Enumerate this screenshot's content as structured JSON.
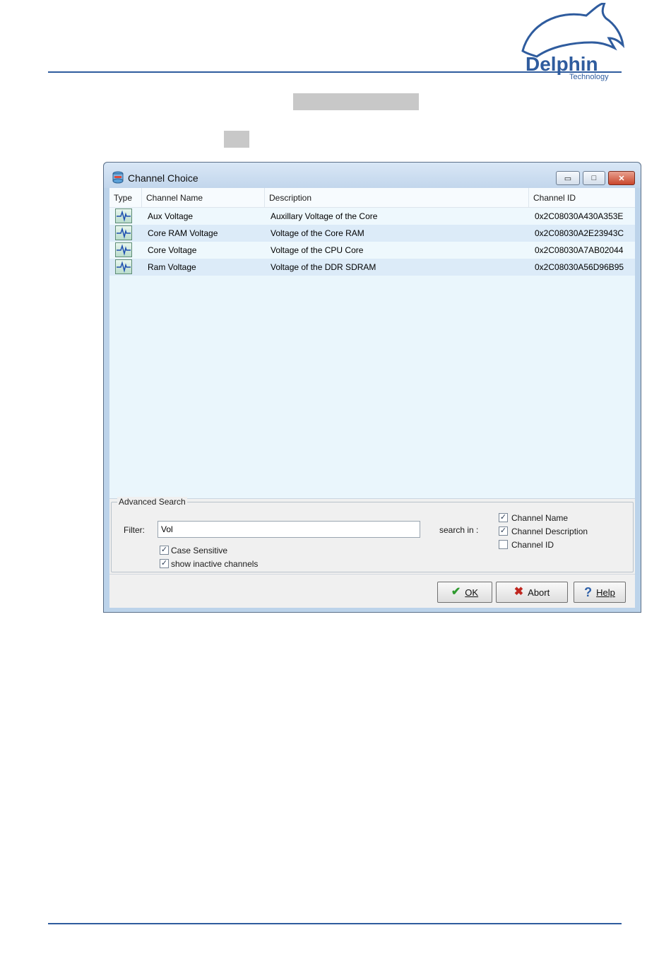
{
  "logo": {
    "brand": "Delphin",
    "sub": "Technology"
  },
  "window": {
    "title": "Channel Choice",
    "controls": {
      "minimize": "▭",
      "maximize": "□",
      "close": "✕"
    }
  },
  "table": {
    "columns": [
      "Type",
      "Channel Name",
      "Description",
      "Channel ID"
    ],
    "rows": [
      {
        "name": "Aux Voltage",
        "description": "Auxillary Voltage of the Core",
        "id": "0x2C08030A430A353E"
      },
      {
        "name": "Core RAM Voltage",
        "description": "Voltage of the Core RAM",
        "id": "0x2C08030A2E23943C"
      },
      {
        "name": "Core Voltage",
        "description": "Voltage of the CPU Core",
        "id": "0x2C08030A7AB02044"
      },
      {
        "name": "Ram Voltage",
        "description": "Voltage of the DDR SDRAM",
        "id": "0x2C08030A56D96B95"
      }
    ]
  },
  "search": {
    "group_title": "Advanced Search",
    "filter_label": "Filter:",
    "filter_value": "Vol",
    "search_in_label": "search in :",
    "options": {
      "channel_name": {
        "label": "Channel Name",
        "checked": true
      },
      "channel_description": {
        "label": "Channel Description",
        "checked": true
      },
      "channel_id": {
        "label": "Channel ID",
        "checked": false
      },
      "case_sensitive": {
        "label": "Case Sensitive",
        "checked": true
      },
      "show_inactive": {
        "label": "show inactive channels",
        "checked": true
      }
    },
    "check_glyph": "✓"
  },
  "buttons": {
    "ok": {
      "label": "OK",
      "icon": "✔"
    },
    "abort": {
      "label": "Abort",
      "icon": "✖"
    },
    "help": {
      "label": "Help",
      "icon": "?"
    }
  },
  "colors": {
    "accent": "#2f5c9e",
    "ok_icon": "#2e9a2e",
    "abort_icon": "#c0261f",
    "help_icon": "#2d5fa8"
  }
}
